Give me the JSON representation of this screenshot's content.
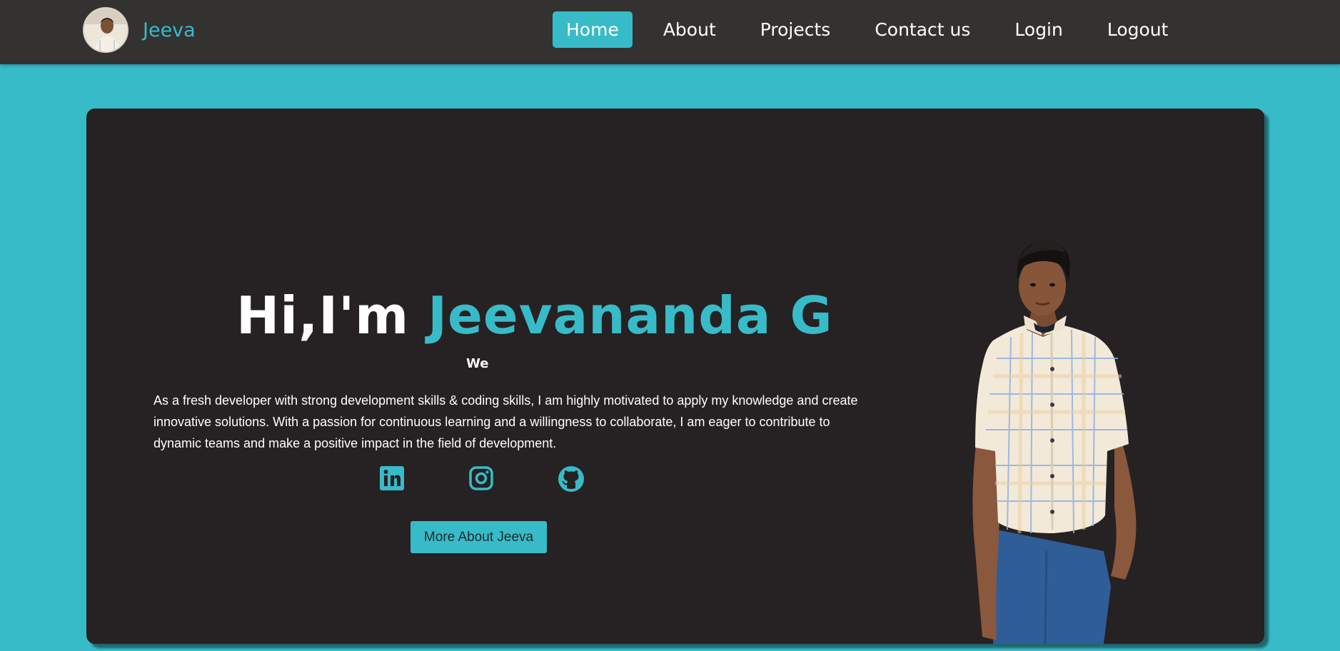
{
  "navbar": {
    "brand_name": "Jeeva",
    "items": [
      {
        "label": "Home",
        "active": true
      },
      {
        "label": "About",
        "active": false
      },
      {
        "label": "Projects",
        "active": false
      },
      {
        "label": "Contact us",
        "active": false
      },
      {
        "label": "Login",
        "active": false
      },
      {
        "label": "Logout",
        "active": false
      }
    ]
  },
  "hero": {
    "greeting": "Hi,I'm",
    "name": "Jeevananda G",
    "typed_text": "We",
    "bio": "As a fresh developer with strong development skills & coding skills, I am highly motivated to apply my knowledge and create innovative solutions. With a passion for continuous learning and a willingness to collaborate, I am eager to contribute to dynamic teams and make a positive impact in the field of development.",
    "socials": [
      {
        "icon": "linkedin-icon"
      },
      {
        "icon": "instagram-icon"
      },
      {
        "icon": "github-icon"
      }
    ],
    "cta_label": "More About Jeeva"
  },
  "colors": {
    "accent": "#38bbc8",
    "navbar_bg": "#333231",
    "card_bg": "#262122",
    "text": "#ffffff"
  }
}
